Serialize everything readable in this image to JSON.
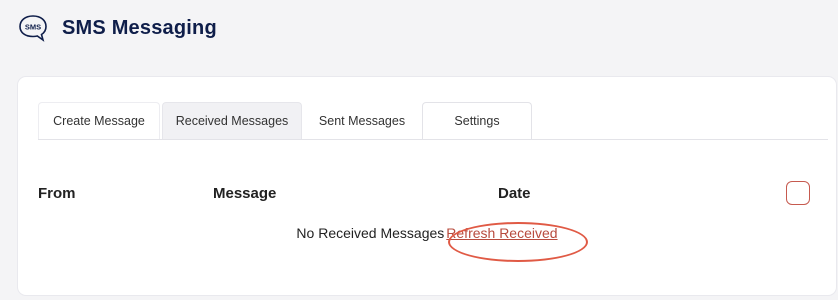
{
  "header": {
    "icon_text": "SMS",
    "title": "SMS Messaging"
  },
  "tabs": [
    {
      "label": "Create Message"
    },
    {
      "label": "Received Messages",
      "active": true
    },
    {
      "label": "Sent Messages"
    },
    {
      "label": "Settings"
    }
  ],
  "table": {
    "columns": {
      "from": "From",
      "message": "Message",
      "date": "Date"
    },
    "empty_text": "No Received Messages",
    "refresh_link": "Refresh Received"
  },
  "colors": {
    "title": "#0f1e4a",
    "accent": "#c65a4f",
    "highlight_circle": "#e05a45"
  }
}
